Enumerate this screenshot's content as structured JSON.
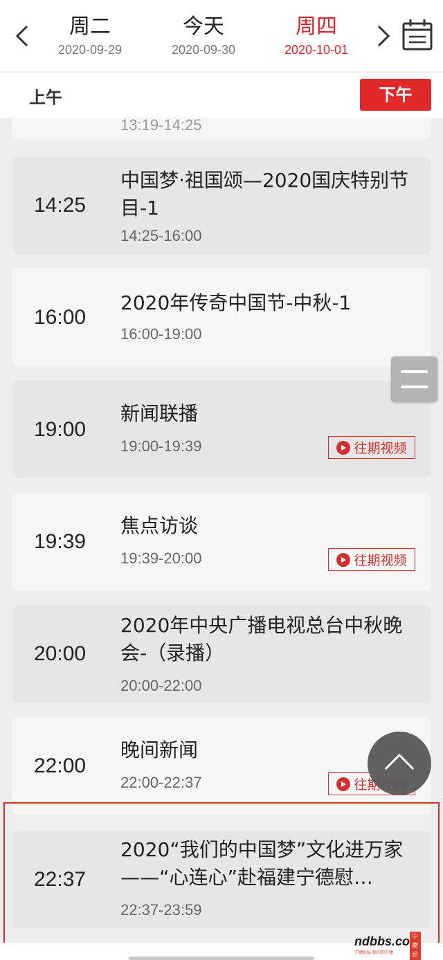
{
  "date_nav": {
    "days": [
      {
        "name": "周二",
        "date": "2020-09-29"
      },
      {
        "name": "今天",
        "date": "2020-09-30"
      },
      {
        "name": "周四",
        "date": "2020-10-01"
      }
    ],
    "active_index": 2
  },
  "period": {
    "am_label": "上午",
    "pm_label": "下午"
  },
  "schedule": {
    "partial_range": "13:19-14:25",
    "programs": [
      {
        "time": "14:25",
        "title": "中国梦·祖国颂—2020国庆特别节目-1",
        "range": "14:25-16:00",
        "replay": ""
      },
      {
        "time": "16:00",
        "title": "2020年传奇中国节-中秋-1",
        "range": "16:00-19:00",
        "replay": ""
      },
      {
        "time": "19:00",
        "title": "新闻联播",
        "range": "19:00-19:39",
        "replay": "往期视频"
      },
      {
        "time": "19:39",
        "title": "焦点访谈",
        "range": "19:39-20:00",
        "replay": "往期视频"
      },
      {
        "time": "20:00",
        "title": "2020年中央广播电视总台中秋晚会-（录播）",
        "range": "20:00-22:00",
        "replay": ""
      },
      {
        "time": "22:00",
        "title": "晚间新闻",
        "range": "22:00-22:37",
        "replay": "往期视频"
      },
      {
        "time": "22:37",
        "title": "2020“我们的中国梦”文化进万家——“心连心”赴福建宁德慰…",
        "range": "22:37-23:59",
        "replay": ""
      }
    ]
  },
  "watermark": {
    "main": "ndbbs.com",
    "badge": "宁德论坛",
    "sub": "宁德论坛·我们的宁德"
  },
  "colors": {
    "accent": "#e02a2a",
    "text": "#222222",
    "muted": "#666666"
  }
}
